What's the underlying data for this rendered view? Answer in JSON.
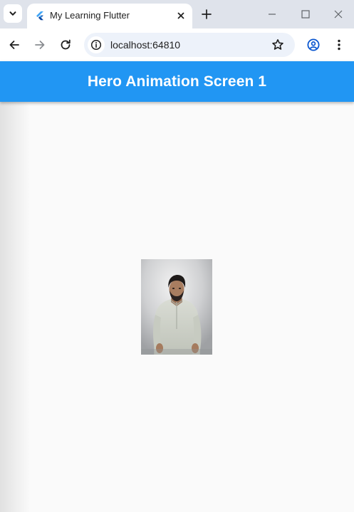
{
  "browser": {
    "tab_title": "My Learning Flutter",
    "url": "localhost:64810"
  },
  "app": {
    "title": "Hero Animation Screen 1",
    "accent": "#2196f3",
    "hero_image_alt": "Hero image"
  },
  "icons": {
    "tab_search": "chevron-down-icon",
    "favicon": "flutter-logo-icon",
    "close": "close-icon",
    "new_tab": "plus-icon",
    "minimize": "minimize-icon",
    "maximize": "maximize-icon",
    "window_close": "close-icon",
    "back": "arrow-left-icon",
    "forward": "arrow-right-icon",
    "reload": "reload-icon",
    "site_info": "info-icon",
    "bookmark": "star-icon",
    "profile": "account-icon",
    "menu": "more-vert-icon"
  }
}
